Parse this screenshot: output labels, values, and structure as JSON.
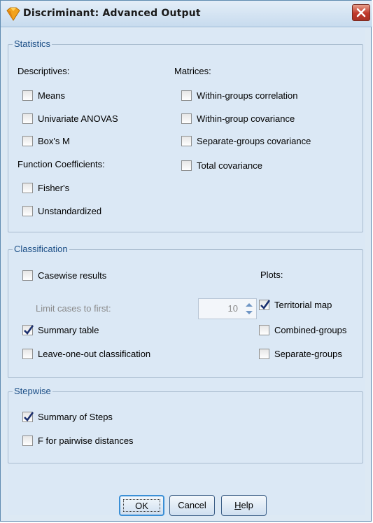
{
  "window": {
    "title": "Discriminant: Advanced Output"
  },
  "statistics": {
    "legend": "Statistics",
    "descriptives_label": "Descriptives:",
    "descriptives": [
      {
        "label": "Means",
        "checked": false
      },
      {
        "label": "Univariate ANOVAS",
        "checked": false
      },
      {
        "label": "Box's M",
        "checked": false
      }
    ],
    "function_coefficients_label": "Function Coefficients:",
    "function_coefficients": [
      {
        "label": "Fisher's",
        "checked": false
      },
      {
        "label": "Unstandardized",
        "checked": false
      }
    ],
    "matrices_label": "Matrices:",
    "matrices": [
      {
        "label": "Within-groups correlation",
        "checked": false
      },
      {
        "label": "Within-group covariance",
        "checked": false
      },
      {
        "label": "Separate-groups covariance",
        "checked": false
      },
      {
        "label": "Total covariance",
        "checked": false
      }
    ]
  },
  "classification": {
    "legend": "Classification",
    "casewise": {
      "label": "Casewise results",
      "checked": false
    },
    "limit_label": "Limit cases to first:",
    "limit_value": "10",
    "summary_table": {
      "label": "Summary table",
      "checked": true
    },
    "leave_one_out": {
      "label": "Leave-one-out classification",
      "checked": false
    },
    "plots_label": "Plots:",
    "plots": [
      {
        "label": "Territorial map",
        "checked": true
      },
      {
        "label": "Combined-groups",
        "checked": false
      },
      {
        "label": "Separate-groups",
        "checked": false
      }
    ]
  },
  "stepwise": {
    "legend": "Stepwise",
    "summary_of_steps": {
      "label": "Summary of Steps",
      "checked": true
    },
    "f_pairwise": {
      "label": "F for pairwise distances",
      "checked": false
    }
  },
  "buttons": {
    "ok": "OK",
    "cancel": "Cancel",
    "help_mnemonic": "H",
    "help_rest": "elp"
  },
  "colors": {
    "accent": "#1b4e86",
    "close": "#c0392b",
    "check": "#1a2f6e"
  }
}
